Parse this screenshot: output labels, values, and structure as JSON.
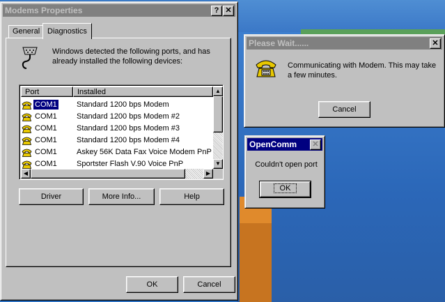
{
  "modems_window": {
    "title": "Modems Properties",
    "help_btn": "?",
    "close_btn": "✕",
    "tabs": [
      {
        "label": "General"
      },
      {
        "label": "Diagnostics"
      }
    ],
    "description": "Windows detected the following ports, and has already installed the following devices:",
    "columns": {
      "port": "Port",
      "installed": "Installed"
    },
    "rows": [
      {
        "port": "COM1",
        "installed": "Standard  1200 bps Modem"
      },
      {
        "port": "COM1",
        "installed": "Standard  1200 bps Modem #2"
      },
      {
        "port": "COM1",
        "installed": "Standard  1200 bps Modem #3"
      },
      {
        "port": "COM1",
        "installed": "Standard  1200 bps Modem #4"
      },
      {
        "port": "COM1",
        "installed": "Askey 56K Data Fax Voice Modem PnP"
      },
      {
        "port": "COM1",
        "installed": "Sportster Flash V.90 Voice PnP"
      }
    ],
    "buttons": {
      "driver": "Driver",
      "more_info": "More Info...",
      "help": "Help",
      "ok": "OK",
      "cancel": "Cancel"
    }
  },
  "wait_window": {
    "title": "Please Wait......",
    "close_btn": "✕",
    "message": "Communicating with Modem. This may take a few minutes.",
    "cancel": "Cancel"
  },
  "opencomm_window": {
    "title": "OpenComm",
    "close_btn": "✕",
    "message": "Couldn't open port",
    "ok": "OK"
  },
  "colors": {
    "title_active": "#000080",
    "title_inactive": "#808080",
    "selection": "#000080",
    "face": "#c0c0c0"
  }
}
